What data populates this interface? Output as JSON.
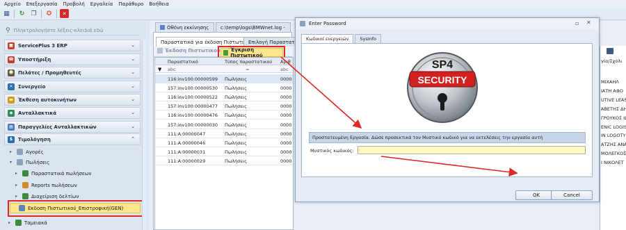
{
  "menu": [
    "Αρχείο",
    "Επεξεργασία",
    "Προβολή",
    "Εργαλεία",
    "Παράθυρο",
    "Βοήθεια"
  ],
  "toolbar_icons": [
    "layout-icon",
    "refresh-icon",
    "window-icon",
    "help-icon",
    "close-icon"
  ],
  "search": {
    "placeholder": "Πληκτρολογήστε λέξεις-κλειδιά εδώ"
  },
  "nav": {
    "items": [
      {
        "label": "ServicePlus 3 ERP",
        "icon": "erp-icon",
        "color": "#d23a2a"
      },
      {
        "label": "Υποστήριξη",
        "icon": "phone-icon",
        "color": "#c0392b"
      },
      {
        "label": "Πελάτες / Προμηθευτές",
        "icon": "people-icon",
        "color": "#6b5a3a"
      },
      {
        "label": "Συνεργείο",
        "icon": "wrench-icon",
        "color": "#2a6fb0"
      },
      {
        "label": "Έκθεση αυτοκινήτων",
        "icon": "car-icon",
        "color": "#d89a1e"
      },
      {
        "label": "Ανταλλακτικά",
        "icon": "parts-icon",
        "color": "#2e8b57"
      },
      {
        "label": "Παραγγελίες Ανταλλακτικών",
        "icon": "orders-icon",
        "color": "#4a7bbf"
      },
      {
        "label": "Τιμολόγηση",
        "icon": "invoice-icon",
        "color": "#2d6cb4"
      }
    ],
    "tree": {
      "agores": "Αγορές",
      "poliseis": "Πωλήσεις",
      "parastatika": "Παραστατικά πωλήσεων",
      "reports": "Reports πωλήσεων",
      "diaxeirisi": "Διαχείριση δελτίων",
      "ekdosi": "Εκδοση Πιστωτικού_Επιστροφική(GEN)",
      "tameiaka": "Ταμειακά"
    }
  },
  "center": {
    "tabs": [
      "Οθόνη εκκίνησης",
      "c:\\temp\\logs\\BMWnet.log -"
    ],
    "subtabs": [
      "Παραστατικά για έκδοση Πιστωτικού",
      "Επιλογή Παραστατικα"
    ],
    "btn_issue": "Έκδοση Πιστωτικού",
    "btn_approve": "Έγκριση Πιστωτικού",
    "columns": [
      "Παραστατικό",
      "Τύπος παραστατικού",
      "Αριθ"
    ],
    "filters": [
      "abc",
      "=",
      "abc"
    ],
    "rows": [
      [
        "116:inv100:00000599",
        "Πωλήσεις",
        "0000"
      ],
      [
        "157:inv100:00000530",
        "Πωλήσεις",
        "0000"
      ],
      [
        "116:inv100:00000522",
        "Πωλήσεις",
        "0000"
      ],
      [
        "157:inv100:00000477",
        "Πωλήσεις",
        "0000"
      ],
      [
        "116:inv100:00000476",
        "Πωλήσεις",
        "0000"
      ],
      [
        "157:inv100:00000030",
        "Πωλήσεις",
        "0000"
      ],
      [
        "111:A:00000047",
        "Πωλήσεις",
        "0000"
      ],
      [
        "111:A:00000046",
        "Πωλήσεις",
        "0000"
      ],
      [
        "111:A:00000031",
        "Πωλήσεις",
        "0000"
      ],
      [
        "111:A:00000029",
        "Πωλήσεις",
        "0000"
      ]
    ],
    "right_col_header": "γία/Σχόλι",
    "right_col": [
      "ΜΙΧΑΗΛ",
      "ΙΑΤΗ ΑΦΟ",
      "UTIVE LEAS",
      "ΑΒΕΤΗΣ ΔΗΙ",
      "ΓΡΟΥΚΟΣ ΙΩΑ",
      "ENIC LOGIST",
      "ΙΝ LOGOTY",
      "ΑΤΖΗΣ ΑΝΑ",
      "ΜΟΛΕΓΚΟΣ",
      "Ι ΝΙΚΟΛΕΤ"
    ]
  },
  "dialog": {
    "title": "Enter Password",
    "tabs": [
      "Κωδικοί ενεργειών",
      "SysInfo"
    ],
    "logo_top": "SP4",
    "logo_text": "SECURITY",
    "message": "Προστατευμένη Εργασία. Δώσε προσεκτικά τον Μυστικό κωδικό για να εκτελέσεις την εργασία αυτή",
    "pw_label": "Μυστικός κωδικός:",
    "pw_value": "",
    "ok": "OK",
    "cancel": "Cancel"
  },
  "colors": {
    "highlight_red": "#e12727",
    "selected_item": "#fbe68a",
    "password_bg": "#fdf8c4"
  }
}
